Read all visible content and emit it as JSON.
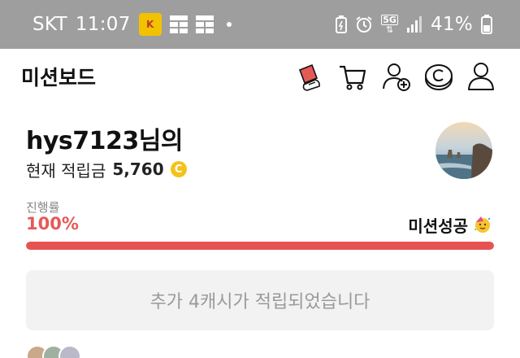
{
  "status_bar": {
    "carrier": "SKT",
    "time": "11:07",
    "battery": "41%",
    "network": "5G",
    "icons": [
      "carrier-badge-icon",
      "grid-icon",
      "grid-icon",
      "dot-icon",
      "battery-saver-icon",
      "alarm-icon",
      "network-5g-icon",
      "signal-icon",
      "battery-icon"
    ]
  },
  "header": {
    "title": "미션보드",
    "icons": [
      "mission-card-icon",
      "cart-icon",
      "add-user-icon",
      "coin-c-icon",
      "profile-icon"
    ],
    "accent": "#e45a57"
  },
  "profile": {
    "username": "hys7123님의",
    "points_label": "현재 적립금",
    "points_value": "5,760",
    "coin_symbol": "C"
  },
  "progress": {
    "label": "진행률",
    "percent_text": "100%",
    "percent_value": 100,
    "status": "미션성공",
    "status_icon": "party-face-icon",
    "bar_color": "#e65451"
  },
  "notice": {
    "text": "추가 4캐시가 적립되었습니다"
  }
}
